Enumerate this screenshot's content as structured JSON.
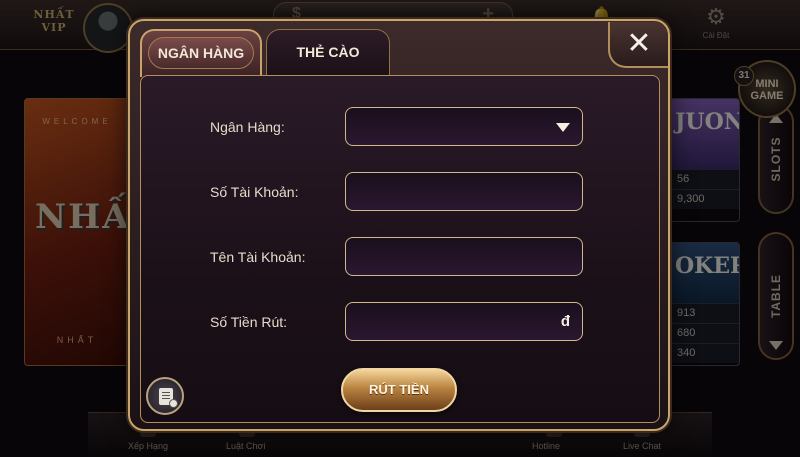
{
  "background": {
    "logo_text": "NHẤT\nVIP",
    "settings_label": "Cài Đặt",
    "welcome_top": "WELCOME",
    "welcome_big": "NHẤT",
    "welcome_bottom": "NHẤT",
    "card_a": {
      "title": "JUONG",
      "values": [
        "56",
        "9,300"
      ]
    },
    "card_b": {
      "title": "OKER",
      "values": [
        "913",
        "680",
        "340"
      ]
    },
    "side_tabs": {
      "slots": "SLOTS",
      "table": "TABLE"
    },
    "minigame": {
      "label_line1": "MINI",
      "label_line2": "GAME",
      "badge": "31"
    },
    "bottom_bar": [
      "Xếp Hạng",
      "Luật Chơi",
      "Hotline",
      "Live Chat"
    ]
  },
  "modal": {
    "tabs": [
      {
        "label": "NGÂN HÀNG",
        "active": true
      },
      {
        "label": "THẺ CÀO",
        "active": false
      }
    ],
    "close_glyph": "✕",
    "fields": [
      {
        "label": "Ngân Hàng:",
        "type": "select",
        "value": ""
      },
      {
        "label": "Số Tài Khoản:",
        "type": "text",
        "value": ""
      },
      {
        "label": "Tên Tài Khoản:",
        "type": "text",
        "value": ""
      },
      {
        "label": "Số Tiền Rút:",
        "type": "amount",
        "value": "",
        "unit": "đ"
      }
    ],
    "withdraw_label": "RÚT TIỀN",
    "icons": {
      "history": "history-document-icon",
      "dropdown": "chevron-down-icon",
      "close": "close-icon"
    }
  },
  "colors": {
    "accent_gold": "#c9a56a",
    "panel_bg": "#1b1018",
    "field_border": "#cfb88a"
  }
}
